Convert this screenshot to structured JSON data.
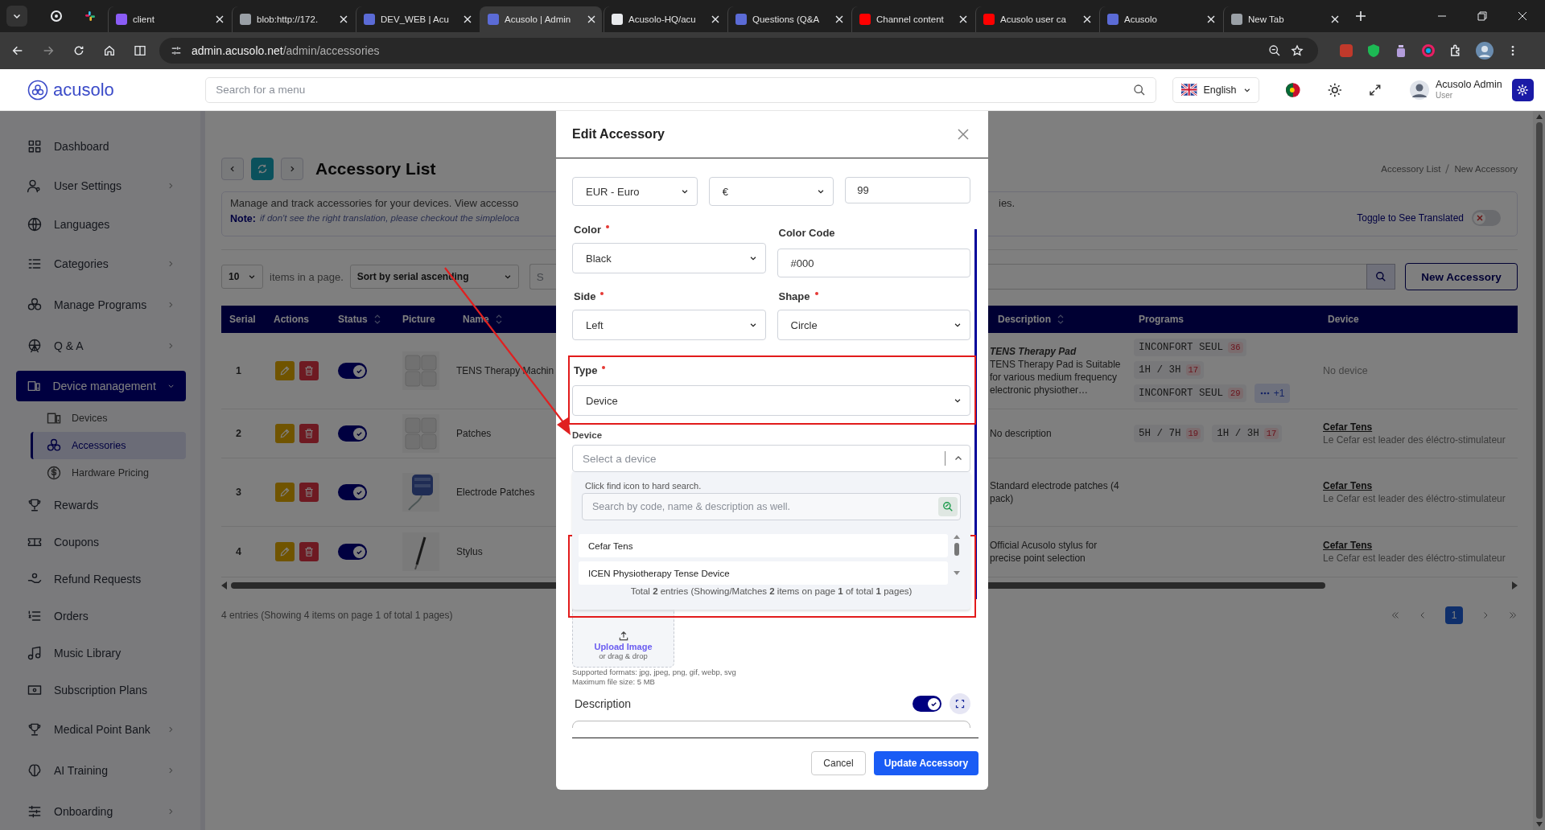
{
  "browser": {
    "tabs": [
      {
        "title": "client",
        "selected": false
      },
      {
        "title": "blob:http://172.",
        "selected": false
      },
      {
        "title": "DEV_WEB | Acu",
        "selected": false
      },
      {
        "title": "Acusolo | Admin",
        "selected": true
      },
      {
        "title": "Acusolo-HQ/acu",
        "selected": false
      },
      {
        "title": "Questions (Q&A",
        "selected": false
      },
      {
        "title": "Channel content",
        "selected": false
      },
      {
        "title": "Acusolo user ca",
        "selected": false
      },
      {
        "title": "Acusolo",
        "selected": false
      },
      {
        "title": "New Tab",
        "selected": false
      }
    ],
    "url_host": "admin.acusolo.net",
    "url_path": "/admin/accessories"
  },
  "header": {
    "logo": "acusolo",
    "search_placeholder": "Search for a menu",
    "language": "English",
    "user_name": "Acusolo Admin",
    "user_role": "User"
  },
  "sidebar": {
    "items": [
      {
        "label": "Dashboard",
        "selected": false
      },
      {
        "label": "User Settings",
        "expanded": false,
        "selected": false
      },
      {
        "label": "Languages",
        "selected": false
      },
      {
        "label": "Categories",
        "expanded": false,
        "selected": false
      },
      {
        "label": "Manage Programs",
        "expanded": false,
        "selected": false
      },
      {
        "label": "Q & A",
        "expanded": false,
        "selected": false
      },
      {
        "label": "Device management",
        "expanded": true,
        "selected": true,
        "children": [
          {
            "label": "Devices",
            "selected": false
          },
          {
            "label": "Accessories",
            "selected": true
          },
          {
            "label": "Hardware Pricing",
            "selected": false
          }
        ]
      },
      {
        "label": "Rewards",
        "selected": false
      },
      {
        "label": "Coupons",
        "selected": false
      },
      {
        "label": "Refund Requests",
        "selected": false
      },
      {
        "label": "Orders",
        "selected": false
      },
      {
        "label": "Music Library",
        "selected": false
      },
      {
        "label": "Subscription Plans",
        "selected": false
      },
      {
        "label": "Medical Point Bank",
        "expanded": false,
        "selected": false
      },
      {
        "label": "AI Training",
        "expanded": false,
        "selected": false
      },
      {
        "label": "Onboarding",
        "expanded": false,
        "selected": false
      }
    ]
  },
  "page": {
    "title": "Accessory List",
    "breadcrumb": [
      "Accessory List",
      "New Accessory"
    ],
    "intro_left": "Manage and track accessories for your devices. View accesso",
    "intro_right": "ies.",
    "note_label": "Note:",
    "note_text": "if don't see the right translation, please checkout the simpleloca",
    "translate_toggle": {
      "label": "Toggle to See Translated",
      "on": false
    },
    "page_size": "10",
    "page_size_label": "items in a page.",
    "sort": "Sort by serial ascending",
    "search_placeholder": "S",
    "new_button": "New Accessory"
  },
  "table": {
    "columns_left": [
      {
        "label": "Serial",
        "sortable": false
      },
      {
        "label": "Actions",
        "sortable": false
      },
      {
        "label": "Status",
        "sortable": true
      },
      {
        "label": "Picture",
        "sortable": false
      },
      {
        "label": "Name",
        "sortable": true
      }
    ],
    "columns_right": [
      {
        "label": "Description",
        "sortable": true
      },
      {
        "label": "Programs",
        "sortable": false
      },
      {
        "label": "Device",
        "sortable": false
      }
    ],
    "rows": [
      {
        "serial": "1",
        "status_on": true,
        "name": "TENS Therapy Machin",
        "description_title": "TENS Therapy Pad",
        "description": "TENS Therapy Pad is Suitable for various medium frequency electronic physiother…",
        "programs": [
          {
            "label": "INCONFORT SEUL",
            "count": "36"
          },
          {
            "label": "1H / 3H",
            "count": "17"
          },
          {
            "label": "INCONFORT SEUL",
            "count": "29"
          }
        ],
        "more": "+1",
        "device": {
          "kind": "none",
          "text": "No device"
        }
      },
      {
        "serial": "2",
        "status_on": true,
        "name": "Patches",
        "description": "No description",
        "programs": [
          {
            "label": "5H / 7H",
            "count": "19"
          },
          {
            "label": "1H / 3H",
            "count": "17"
          }
        ],
        "device": {
          "kind": "link",
          "name": "Cefar Tens",
          "detail": "Le Cefar est leader des éléctro-stimulateur"
        }
      },
      {
        "serial": "3",
        "status_on": true,
        "name": "Electrode Patches",
        "description": "Standard electrode patches (4 pack)",
        "programs": [],
        "device": {
          "kind": "link",
          "name": "Cefar Tens",
          "detail": "Le Cefar est leader des éléctro-stimulateur"
        }
      },
      {
        "serial": "4",
        "status_on": true,
        "name": "Stylus",
        "description": "Official Acusolo stylus for precise point selection",
        "programs": [],
        "device": {
          "kind": "link",
          "name": "Cefar Tens",
          "detail": "Le Cefar est leader des éléctro-stimulateur"
        }
      }
    ],
    "footer": "4 entries (Showing 4 items on page 1 of total 1 pages)",
    "pages": [
      {
        "label": "1",
        "selected": true
      }
    ]
  },
  "modal": {
    "title": "Edit Accessory",
    "currency": "EUR - Euro",
    "symbol": "€",
    "price": "99",
    "fields": [
      {
        "kind": "select",
        "label": "Color",
        "required": true,
        "value": "Black"
      },
      {
        "kind": "input",
        "label": "Color Code",
        "value": "#000"
      },
      {
        "kind": "select",
        "label": "Side",
        "required": true,
        "value": "Left"
      },
      {
        "kind": "select",
        "label": "Shape",
        "required": true,
        "value": "Circle"
      }
    ],
    "type_field": {
      "label": "Type",
      "required": true,
      "value": "Device"
    },
    "device": {
      "label": "Device",
      "placeholder": "Select a device",
      "expanded": true,
      "hint": "Click find icon to hard search.",
      "search_placeholder": "Search by code, name & description as well.",
      "options": [
        {
          "label": "Cefar Tens",
          "selected": false
        },
        {
          "label": "ICEN Physiotherapy Tense Device",
          "selected": false
        }
      ],
      "total": "Total  **2** entries (Showing/Matches **2** items on page **1** of total **1** pages)"
    },
    "upload": {
      "label": "Upload Image",
      "sub": "or drag & drop",
      "formats": "Supported formats: jpg, jpeg, png, gif, webp, svg",
      "max_size": "Maximum file size: 5 MB"
    },
    "description": {
      "label": "Description",
      "rich_on": true
    },
    "buttons": {
      "cancel": "Cancel",
      "submit": "Update Accessory"
    }
  }
}
